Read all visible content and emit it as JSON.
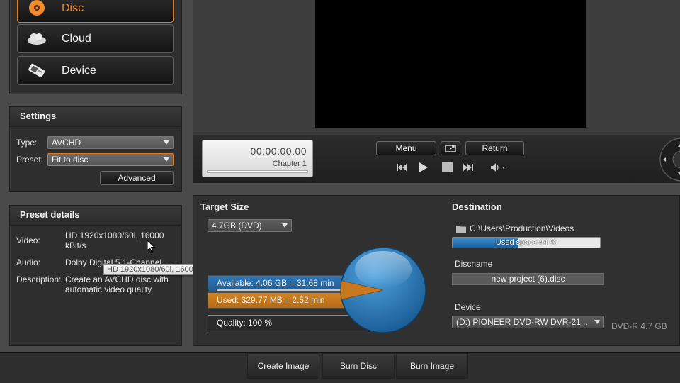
{
  "nav": {
    "items": [
      {
        "label": "Disc",
        "icon": "disc-icon",
        "active": true
      },
      {
        "label": "Cloud",
        "icon": "cloud-icon",
        "active": false
      },
      {
        "label": "Device",
        "icon": "device-icon",
        "active": false
      }
    ]
  },
  "settings": {
    "title": "Settings",
    "type_label": "Type:",
    "type_value": "AVCHD",
    "preset_label": "Preset:",
    "preset_value": "Fit to disc",
    "advanced_label": "Advanced"
  },
  "preset_details": {
    "title": "Preset details",
    "video_label": "Video:",
    "video_value": "HD 1920x1080/60i, 16000 kBit/s",
    "audio_label": "Audio:",
    "audio_value": "Dolby Digital 5.1-Channel",
    "description_label": "Description:",
    "description_value": "Create an AVCHD disc with automatic video quality",
    "tooltip": "HD 1920x1080/60i, 16000 kBit/s"
  },
  "player": {
    "timecode": "00:00:00.00",
    "chapter": "Chapter 1",
    "menu_label": "Menu",
    "return_label": "Return"
  },
  "target": {
    "title": "Target Size",
    "size_value": "4.7GB (DVD)",
    "available": "Available:  4.06 GB = 31.68 min",
    "used": "Used:  329.77 MB = 2.52 min",
    "quality": "Quality:   100 %",
    "used_fraction": 0.07
  },
  "destination": {
    "title": "Destination",
    "path": "C:\\Users\\Production\\Videos",
    "used_space": "Used space 44 %",
    "used_space_fraction": 0.44,
    "discname_label": "Discname",
    "discname_value": "new project (6).disc",
    "device_label": "Device",
    "device_value": "(D:) PIONEER DVD-RW  DVR-21...",
    "media": "DVD-R 4.7 GB"
  },
  "bottom": {
    "create_image": "Create Image",
    "burn_disc": "Burn Disc",
    "burn_image": "Burn Image"
  },
  "colors": {
    "accent": "#e07a1c",
    "used_bar": "#c8781e",
    "available_bar": "#2a6ea8"
  }
}
